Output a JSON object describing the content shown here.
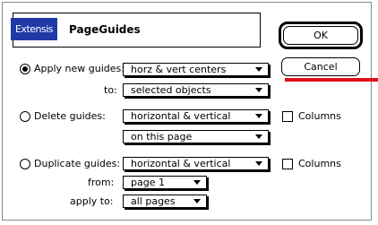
{
  "dialog": {
    "brand": "Extensis",
    "title": "PageGuides",
    "buttons": {
      "ok": "OK",
      "cancel": "Cancel"
    }
  },
  "apply": {
    "label": "Apply new guides:",
    "guides_value": "horz & vert centers",
    "to_label": "to:",
    "to_value": "selected objects",
    "selected": true
  },
  "delete": {
    "label": "Delete guides:",
    "guides_value": "horizontal & vertical",
    "scope_value": "on this page",
    "columns_label": "Columns",
    "selected": false
  },
  "duplicate": {
    "label": "Duplicate guides:",
    "guides_value": "horizontal & vertical",
    "columns_label": "Columns",
    "from_label": "from:",
    "from_value": "page 1",
    "apply_to_label": "apply to:",
    "apply_to_value": "all pages",
    "selected": false
  },
  "colors": {
    "brand_bg": "#1f3aa6",
    "annotation": "#e0101a"
  }
}
